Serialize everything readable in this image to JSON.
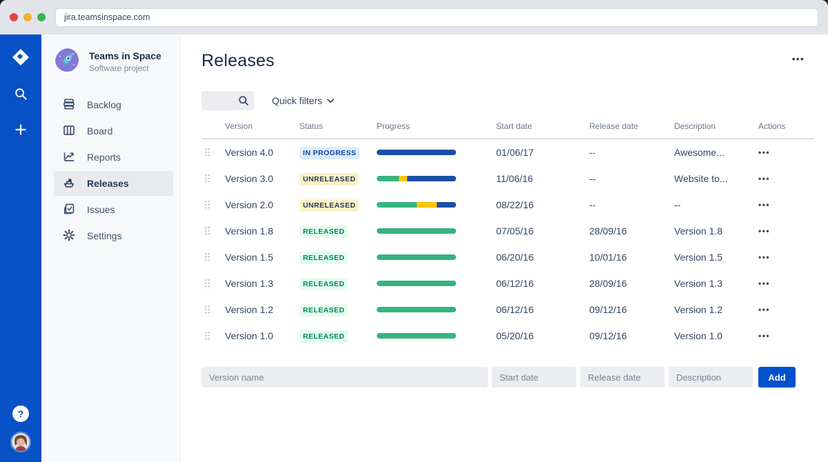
{
  "browser": {
    "url": "jira.teamsinspace.com"
  },
  "rail": {
    "help_glyph": "?"
  },
  "sidebar": {
    "project": {
      "name": "Teams in Space",
      "type": "Software project"
    },
    "items": [
      {
        "label": "Backlog",
        "icon": "backlog-icon",
        "active": false
      },
      {
        "label": "Board",
        "icon": "board-icon",
        "active": false
      },
      {
        "label": "Reports",
        "icon": "reports-icon",
        "active": false
      },
      {
        "label": "Releases",
        "icon": "ship-icon",
        "active": true
      },
      {
        "label": "Issues",
        "icon": "issues-icon",
        "active": false
      },
      {
        "label": "Settings",
        "icon": "gear-icon",
        "active": false
      }
    ]
  },
  "main": {
    "title": "Releases",
    "page_actions_icon": "•••",
    "quick_filters_label": "Quick filters",
    "table": {
      "columns": [
        "Version",
        "Status",
        "Progress",
        "Start date",
        "Release date",
        "Description",
        "Actions"
      ],
      "row_actions_icon": "•••",
      "rows": [
        {
          "version": "Version 4.0",
          "status": "IN PROGRESS",
          "status_type": "inprogress",
          "segments": [
            {
              "color": "navy",
              "pct": 100
            }
          ],
          "start": "01/06/17",
          "release": "--",
          "description": "Awesome..."
        },
        {
          "version": "Version 3.0",
          "status": "UNRELEASED",
          "status_type": "unreleased",
          "segments": [
            {
              "color": "green",
              "pct": 28
            },
            {
              "color": "yellow",
              "pct": 10
            },
            {
              "color": "navy",
              "pct": 62
            }
          ],
          "start": "11/06/16",
          "release": "--",
          "description": "Website to..."
        },
        {
          "version": "Version 2.0",
          "status": "UNRELEASED",
          "status_type": "unreleased",
          "segments": [
            {
              "color": "green",
              "pct": 50
            },
            {
              "color": "yellow",
              "pct": 26
            },
            {
              "color": "navy",
              "pct": 24
            }
          ],
          "start": "08/22/16",
          "release": "--",
          "description": "--"
        },
        {
          "version": "Version 1.8",
          "status": "RELEASED",
          "status_type": "released",
          "segments": [
            {
              "color": "green",
              "pct": 100
            }
          ],
          "start": "07/05/16",
          "release": "28/09/16",
          "description": "Version 1.8"
        },
        {
          "version": "Version 1.5",
          "status": "RELEASED",
          "status_type": "released",
          "segments": [
            {
              "color": "green",
              "pct": 100
            }
          ],
          "start": "06/20/16",
          "release": "10/01/16",
          "description": "Version 1.5"
        },
        {
          "version": "Version 1.3",
          "status": "RELEASED",
          "status_type": "released",
          "segments": [
            {
              "color": "green",
              "pct": 100
            }
          ],
          "start": "06/12/16",
          "release": "28/09/16",
          "description": "Version 1.3"
        },
        {
          "version": "Version 1.2",
          "status": "RELEASED",
          "status_type": "released",
          "segments": [
            {
              "color": "green",
              "pct": 100
            }
          ],
          "start": "06/12/16",
          "release": "09/12/16",
          "description": "Version 1.2"
        },
        {
          "version": "Version 1.0",
          "status": "RELEASED",
          "status_type": "released",
          "segments": [
            {
              "color": "green",
              "pct": 100
            }
          ],
          "start": "05/20/16",
          "release": "09/12/16",
          "description": "Version 1.0"
        }
      ]
    },
    "form": {
      "version_placeholder": "Version name",
      "start_placeholder": "Start date",
      "release_placeholder": "Release date",
      "description_placeholder": "Description",
      "add_label": "Add"
    }
  },
  "colors": {
    "rail_blue": "#0851c6",
    "accent_blue": "#0052cc",
    "progress_green": "#36b37e",
    "progress_yellow": "#ffc400",
    "progress_navy": "#1b4fa5",
    "badge_inprogress_bg": "#deebff",
    "badge_unreleased_bg": "#fcf2c6",
    "badge_released_bg": "#e3fcef"
  }
}
